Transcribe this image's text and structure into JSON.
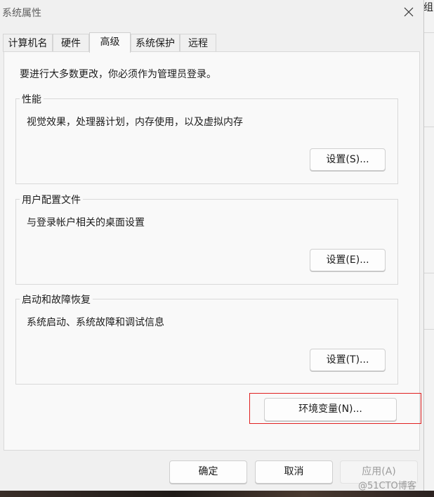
{
  "window": {
    "title": "系统属性",
    "close_icon": "close-icon"
  },
  "tabs": [
    {
      "label": "计算机名",
      "active": false
    },
    {
      "label": "硬件",
      "active": false
    },
    {
      "label": "高级",
      "active": true
    },
    {
      "label": "系统保护",
      "active": false
    },
    {
      "label": "远程",
      "active": false
    }
  ],
  "advanced": {
    "admin_note": "要进行大多数更改，你必须作为管理员登录。",
    "performance": {
      "title": "性能",
      "description": "视觉效果，处理器计划，内存使用，以及虚拟内存",
      "button": "设置(S)..."
    },
    "user_profiles": {
      "title": "用户配置文件",
      "description": "与登录帐户相关的桌面设置",
      "button": "设置(E)..."
    },
    "startup_recovery": {
      "title": "启动和故障恢复",
      "description": "系统启动、系统故障和调试信息",
      "button": "设置(T)..."
    },
    "env_vars_button": "环境变量(N)..."
  },
  "footer": {
    "ok": "确定",
    "cancel": "取消",
    "apply": "应用(A)"
  },
  "background": {
    "glyph": "组",
    "watermark": "@51CTO博客"
  },
  "colors": {
    "highlight_border": "#e02020",
    "dialog_bg": "#f0f0f0",
    "panel_bg": "#f9f9f9"
  }
}
